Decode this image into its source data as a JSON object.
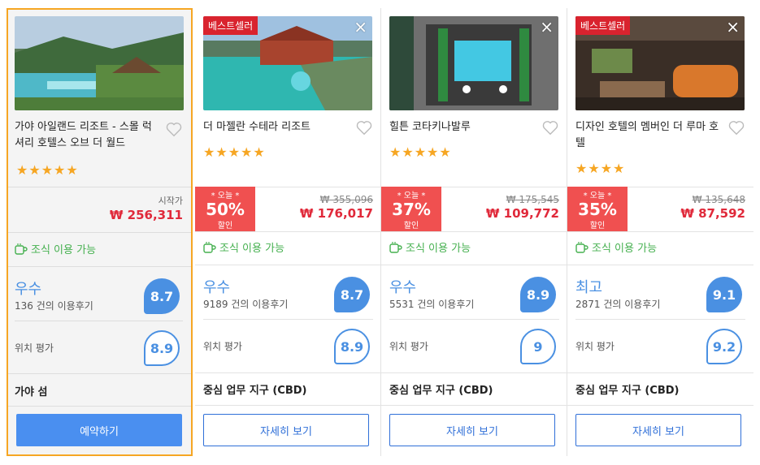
{
  "hotels": [
    {
      "name": "가야 아일랜드 리조트 - 스몰 럭셔리 호텔스 오브 더 월드",
      "badge": "",
      "stars": "★★★★★",
      "from_label": "시작가",
      "price": "₩ 256,311",
      "original_price": "",
      "deal": null,
      "breakfast": "조식 이용 가능",
      "rating_word": "우수",
      "reviews": "136 건의 이용후기",
      "score": "8.7",
      "location_label": "위치 평가",
      "location_score": "8.9",
      "area": "가야 섬",
      "button": "예약하기"
    },
    {
      "name": "더 마젤란 수테라 리조트",
      "badge": "베스트셀러",
      "stars": "★★★★★",
      "from_label": "",
      "price": "₩ 176,017",
      "original_price": "₩ 355,096",
      "deal": {
        "today": "* 오늘 *",
        "pct": "50%",
        "sale": "할인"
      },
      "breakfast": "조식 이용 가능",
      "rating_word": "우수",
      "reviews": "9189 건의 이용후기",
      "score": "8.7",
      "location_label": "위치 평가",
      "location_score": "8.9",
      "area": "중심 업무 지구 (CBD)",
      "button": "자세히 보기"
    },
    {
      "name": "힐튼 코타키나발루",
      "badge": "",
      "stars": "★★★★★",
      "from_label": "",
      "price": "₩ 109,772",
      "original_price": "₩ 175,545",
      "deal": {
        "today": "* 오늘 *",
        "pct": "37%",
        "sale": "할인"
      },
      "breakfast": "조식 이용 가능",
      "rating_word": "우수",
      "reviews": "5531 건의 이용후기",
      "score": "8.9",
      "location_label": "위치 평가",
      "location_score": "9",
      "area": "중심 업무 지구 (CBD)",
      "button": "자세히 보기"
    },
    {
      "name": "디자인 호텔의 멤버인 더 루마 호텔",
      "badge": "베스트셀러",
      "stars": "★★★★",
      "from_label": "",
      "price": "₩ 87,592",
      "original_price": "₩ 135,648",
      "deal": {
        "today": "* 오늘 *",
        "pct": "35%",
        "sale": "할인"
      },
      "breakfast": "조식 이용 가능",
      "rating_word": "최고",
      "reviews": "2871 건의 이용후기",
      "score": "9.1",
      "location_label": "위치 평가",
      "location_score": "9.2",
      "area": "중심 업무 지구 (CBD)",
      "button": "자세히 보기"
    }
  ],
  "close_icon": "×",
  "colors": {
    "accent_blue": "#4a90e2",
    "price_red": "#e0293a",
    "deal_red": "#f05050",
    "breakfast_green": "#45b04f",
    "star_orange": "#f6a623",
    "badge_red": "#d9232e"
  }
}
